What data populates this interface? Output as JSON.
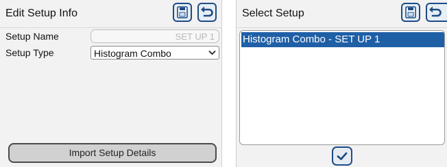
{
  "edit_panel": {
    "title": "Edit Setup Info",
    "setup_name_label": "Setup Name",
    "setup_name_value": "SET UP 1",
    "setup_type_label": "Setup Type",
    "setup_type_value": "Histogram Combo",
    "import_button": "Import Setup Details",
    "icons": [
      "save-icon",
      "back-icon"
    ]
  },
  "select_panel": {
    "title": "Select Setup",
    "items": [
      "Histogram Combo - SET UP 1"
    ],
    "selected_index": 0,
    "icons": [
      "save-icon",
      "back-icon",
      "check-icon"
    ]
  },
  "colors": {
    "accent": "#1c4c86",
    "selection": "#1f5fa6",
    "panel_bg": "#f2f2f2"
  }
}
